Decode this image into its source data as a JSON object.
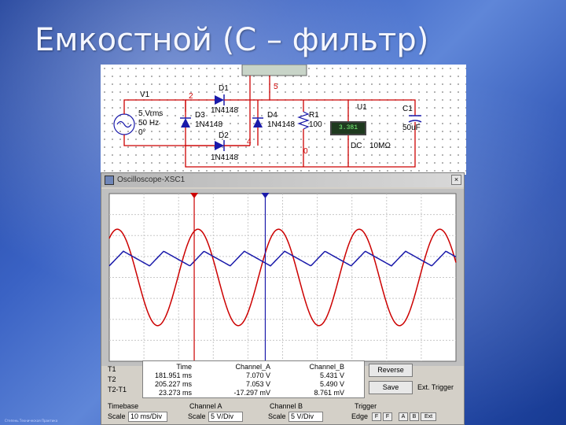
{
  "slide": {
    "title": "Емкостной (С – фильтр)",
    "footer": "Степень Техническая Практика"
  },
  "schematic": {
    "source": {
      "name": "V1",
      "vrms": "5 Vrms",
      "freq": "50 Hz",
      "phase": "0°"
    },
    "nets": {
      "n2": "2",
      "n5": "5",
      "n4": "4",
      "n0": "0"
    },
    "diodes": [
      {
        "ref": "D1",
        "model": "1N4148"
      },
      {
        "ref": "D3",
        "model": "1N4148"
      },
      {
        "ref": "D4",
        "model": "1N4148"
      },
      {
        "ref": "D2",
        "model": "1N4148"
      }
    ],
    "resistor": {
      "ref": "R1",
      "value": "100"
    },
    "meter": {
      "ref": "U1",
      "reading": "3.381",
      "mode": "DC",
      "impedance": "10MΩ"
    },
    "capacitor": {
      "ref": "C1",
      "value": "50uF"
    },
    "colors": {
      "wire": "#cc0000",
      "component": "#1a1aaa",
      "ground": "#cc0000"
    }
  },
  "oscilloscope": {
    "title": "Oscilloscope-XSC1",
    "close_label": "×",
    "screen_bg": "#ffffff",
    "grid_color": "#c8c8c8",
    "cursor_colors": {
      "t1": "#cc0000",
      "t2": "#1a1aaa"
    },
    "cursors": {
      "t1_fraction": 0.245,
      "t2_fraction": 0.45
    },
    "traces": [
      {
        "name": "Channel_A",
        "color": "#cc0000",
        "kind": "sine",
        "amplitude_div": 2.3,
        "cycles": 4.3,
        "phase": 0.15
      },
      {
        "name": "Channel_B",
        "color": "#1a1aaa",
        "kind": "rectified",
        "amplitude_div": 0.7,
        "cycles": 8.6,
        "offset_div": 0.9
      }
    ],
    "readout": {
      "row_labels": [
        "T1",
        "T2",
        "T2-T1"
      ],
      "headers": [
        "Time",
        "Channel_A",
        "Channel_B"
      ],
      "time": [
        "181.951 ms",
        "205.227 ms",
        "23.273 ms"
      ],
      "channel_a": [
        "7.070 V",
        "7.053 V",
        "-17.297 mV"
      ],
      "channel_b": [
        "5.431 V",
        "5.490 V",
        "8.761 mV"
      ]
    },
    "buttons": {
      "reverse": "Reverse",
      "save": "Save",
      "ext_trigger": "Ext. Trigger"
    },
    "timebase": {
      "label": "Timebase",
      "scale_label": "Scale",
      "scale": "10 ms/Div"
    },
    "channel_a": {
      "label": "Channel A",
      "scale_label": "Scale",
      "scale": "5 V/Div"
    },
    "channel_b": {
      "label": "Channel B",
      "scale_label": "Scale",
      "scale": "5 V/Div"
    },
    "trigger": {
      "label": "Trigger",
      "edge_label": "Edge",
      "edge_buttons": [
        "F",
        "F",
        "A",
        "B",
        "Ext"
      ]
    }
  }
}
